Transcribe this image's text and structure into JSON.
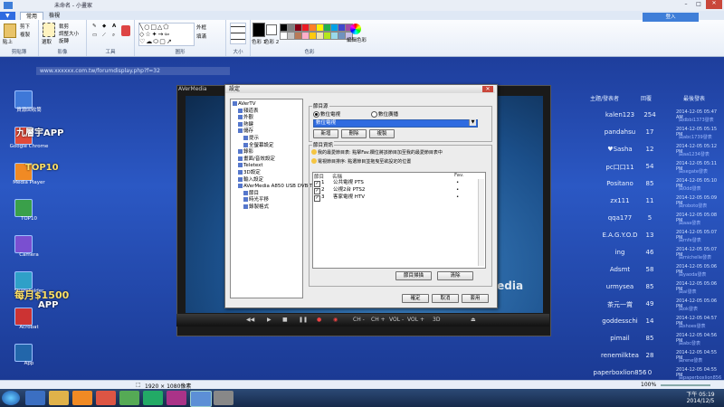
{
  "paint": {
    "title": "未命名 - 小畫家",
    "tabs": [
      "常用",
      "檢視"
    ],
    "signin": "登入",
    "groups": {
      "clipboard": {
        "label": "剪貼簿",
        "paste": "貼上",
        "cut": "剪下",
        "copy": "複製"
      },
      "image": {
        "label": "影像",
        "select": "選取",
        "crop": "裁剪",
        "resize": "調整大小",
        "rotate": "旋轉"
      },
      "tools": {
        "label": "工具"
      },
      "shapes": {
        "label": "圖形",
        "outline": "外框",
        "fill": "填滿"
      },
      "size": {
        "label": "大小"
      },
      "colors": {
        "label": "色彩",
        "color1": "色彩 1",
        "color2": "色彩 2",
        "edit": "編輯色彩"
      }
    },
    "palette": [
      "#000000",
      "#7f7f7f",
      "#880015",
      "#ed1c24",
      "#ff7f27",
      "#fff200",
      "#22b14c",
      "#00a2e8",
      "#3f48cc",
      "#a349a4",
      "#ffffff",
      "#c3c3c3",
      "#b97a57",
      "#ffaec9",
      "#ffc90e",
      "#efe4b0",
      "#b5e61d",
      "#99d9ea",
      "#7092be",
      "#c8bfe7"
    ],
    "status_size": "1920 × 1080像素",
    "zoom": "100%"
  },
  "browser": {
    "address": "www.xxxxxx.com.tw/forumdisplay.php?f=32"
  },
  "desktop_icons": [
    "資源回收筒",
    "Google Chrome",
    "Media Player",
    "TOP10",
    "Camera",
    "ShareFolder",
    "Acrobat",
    "App"
  ],
  "promos": {
    "p1": "九層宇APP",
    "p2": "TOP10",
    "p3": "每月$1500",
    "p4": "APP"
  },
  "forum": {
    "header": [
      "主題/發表者",
      "回覆",
      "最後發表"
    ],
    "rows": [
      {
        "user": "kalen123",
        "count": "254",
        "time": "2014-12-05 05:47 AM",
        "by": "由dbbi1373發表"
      },
      {
        "user": "pandahsu",
        "count": "17",
        "time": "2014-12-05 05:15 PM",
        "by": "由abc1739發表"
      },
      {
        "user": "♥Sasha",
        "count": "12",
        "time": "2014-12-05 05:12 PM",
        "by": "由aa1234發表"
      },
      {
        "user": "pc口口11",
        "count": "54",
        "time": "2014-12-05 05:11 PM",
        "by": "由segate發表"
      },
      {
        "user": "Positano",
        "count": "85",
        "time": "2014-12-05 05:10 PM",
        "by": "由0dd發表"
      },
      {
        "user": "zx111",
        "count": "11",
        "time": "2014-12-05 05:09 PM",
        "by": "由roboto發表"
      },
      {
        "user": "qqa177",
        "count": "5",
        "time": "2014-12-05 05:08 PM",
        "by": "由aaa發表"
      },
      {
        "user": "E.A.G.Y.O.D",
        "count": "13",
        "time": "2014-12-05 05:07 PM",
        "by": "由mfe發表"
      },
      {
        "user": "ing",
        "count": "46",
        "time": "2014-12-05 05:07 PM",
        "by": "由michelle發表"
      },
      {
        "user": "Adsmt",
        "count": "58",
        "time": "2014-12-05 05:06 PM",
        "by": "由yaoda發表"
      },
      {
        "user": "urmysea",
        "count": "85",
        "time": "2014-12-05 05:06 PM",
        "by": "由ai發表"
      },
      {
        "user": "茶元一賞",
        "count": "49",
        "time": "2014-12-05 05:06 PM",
        "by": "由ok發表"
      },
      {
        "user": "goddesschi",
        "count": "14",
        "time": "2014-12-05 04:57 PM",
        "by": "由shoes發表"
      },
      {
        "user": "pimail",
        "count": "85",
        "time": "2014-12-05 04:56 PM",
        "by": "由abc發表"
      },
      {
        "user": "renemilktea",
        "count": "28",
        "time": "2014-12-05 04:55 PM",
        "by": "由rene發表"
      },
      {
        "user": "paperboxlion856",
        "count": "0",
        "time": "2014-12-05 04:55 PM",
        "by": "由paperboxlion856發表"
      }
    ]
  },
  "player": {
    "title": "AVerMedia",
    "logo": "ledia",
    "controls": [
      "CH -",
      "CH +",
      "VOL -",
      "VOL +",
      "3D"
    ]
  },
  "dialog": {
    "title": "設定",
    "tree": [
      "AVerTV",
      "頻道表",
      "外觀",
      "熱鍵",
      "儲存",
      "提示",
      "全螢幕設定",
      "錄影",
      "畫面/音效設定",
      "Teletext",
      "3D設定",
      "輸入設定",
      "AVerMedia A850 USB DVB-T",
      "節目",
      "時光平移",
      "錄製格式"
    ],
    "group_program_source": "節目源",
    "radio_digital": "數位電視",
    "radio_broadcast": "數位廣播",
    "select_value": "數位電視",
    "btn_add": "新增",
    "btn_delete": "刪除",
    "btn_copy": "複製",
    "group_program_info": "節目資訊",
    "hint1": "我的最愛節目表: 點擊Fav.欄位將該節目加至我的最愛節目表中",
    "hint2": "電視節目排序: 點選節目並拖曳至欲設定的位置",
    "col_order": "節目",
    "col_name": "名稱",
    "col_fav": "Fav.",
    "channels": [
      {
        "no": "1",
        "name": "公共電視 PTS",
        "checked": true
      },
      {
        "no": "2",
        "name": "公視2台 PTS2",
        "checked": true
      },
      {
        "no": "3",
        "name": "客家電視 HTV",
        "checked": true
      }
    ],
    "btn_scan": "節目掃描",
    "btn_clear": "清除",
    "btn_ok": "確定",
    "btn_cancel": "取消",
    "btn_apply": "套用"
  },
  "taskbar": {
    "time": "下午 05:19",
    "date": "2014/12/5"
  }
}
